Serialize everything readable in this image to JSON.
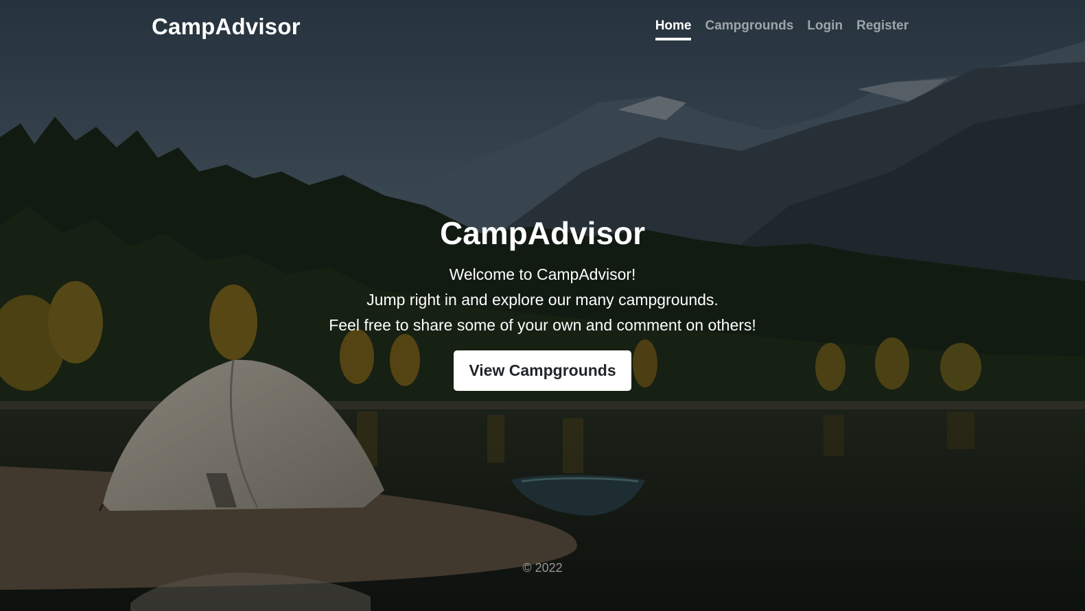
{
  "navbar": {
    "brand": "CampAdvisor",
    "links": [
      {
        "label": "Home",
        "active": true
      },
      {
        "label": "Campgrounds",
        "active": false
      },
      {
        "label": "Login",
        "active": false
      },
      {
        "label": "Register",
        "active": false
      }
    ]
  },
  "hero": {
    "title": "CampAdvisor",
    "lines": [
      "Welcome to CampAdvisor!",
      "Jump right in and explore our many campgrounds.",
      "Feel free to share some of your own and comment on others!"
    ],
    "button_label": "View Campgrounds"
  },
  "footer": {
    "copyright": "© 2022"
  }
}
